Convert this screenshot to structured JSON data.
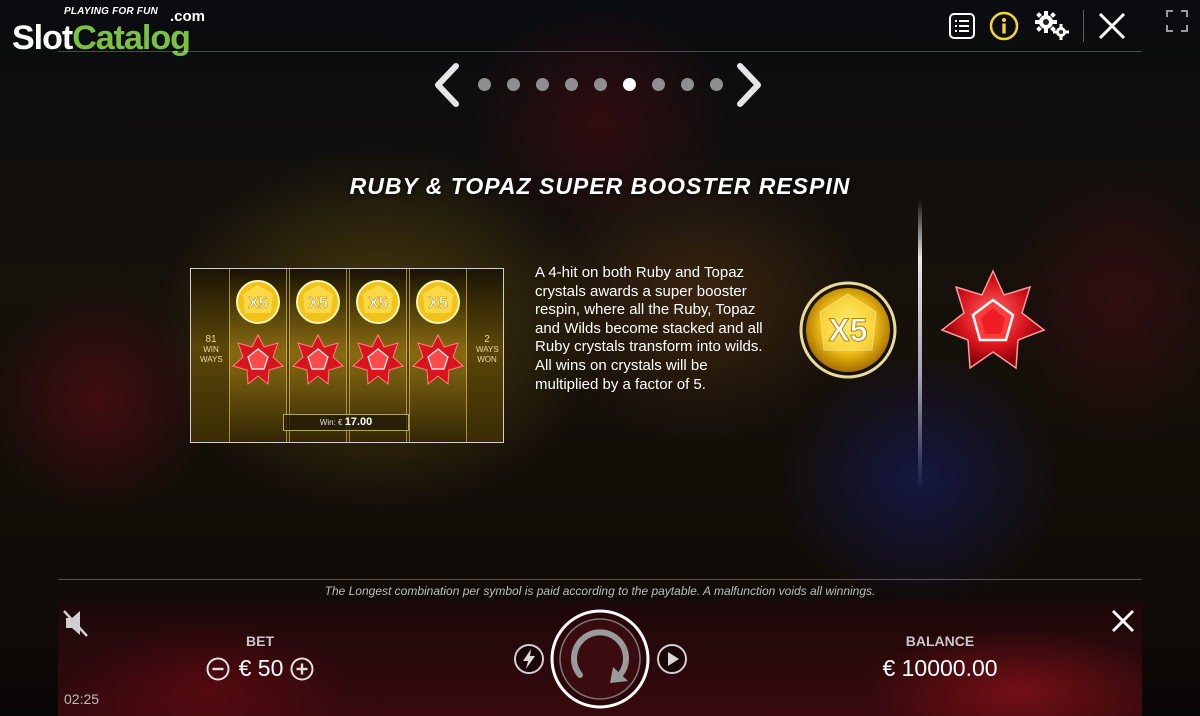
{
  "logo": {
    "tagline": "PLAYING FOR FUN",
    "brand_slot": "Slot",
    "brand_catalog": "Catalog",
    "domain": ".com"
  },
  "toolbar": {
    "icons": [
      "menu-list-icon",
      "info-icon",
      "settings-gears-icon",
      "close-icon",
      "fullscreen-icon"
    ],
    "info_color": "#f2d43a"
  },
  "pager": {
    "total_pages": 9,
    "active_page": 6
  },
  "page": {
    "title": "RUBY & TOPAZ SUPER BOOSTER RESPIN",
    "description": "A 4-hit on both Ruby and Topaz crystals awards a super booster respin, where all the Ruby, Topaz and Wilds become stacked and all Ruby crystals transform into wilds. All wins on crystals will be multiplied by a factor of 5."
  },
  "preview": {
    "left_label_number": "81",
    "left_label_text": "WIN WAYS",
    "right_label_number": "2",
    "right_label_text": "WAYS WON",
    "multiplier_text": "X5",
    "win_label": "Win: €",
    "win_amount": "17.00"
  },
  "symbols": {
    "topaz_multiplier": "X5",
    "topaz_color": "#f5c518",
    "ruby_color": "#d8141c"
  },
  "disclaimer": "The Longest combination per symbol is paid according to the paytable. A malfunction voids all winnings.",
  "bottom_bar": {
    "bet_label": "BET",
    "bet_value": "€ 50",
    "balance_label": "BALANCE",
    "balance_value": "€ 10000.00",
    "clock": "02:25",
    "icons": [
      "sound-off-icon",
      "minus-circle-icon",
      "plus-circle-icon",
      "turbo-lightning-icon",
      "spin-icon",
      "autoplay-icon",
      "close-icon"
    ]
  }
}
